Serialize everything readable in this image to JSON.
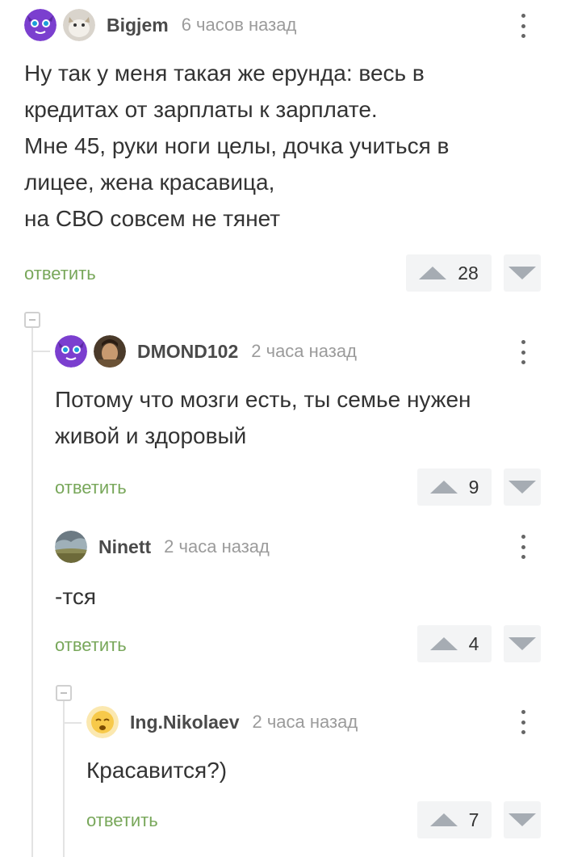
{
  "comments": [
    {
      "username": "Bigjem",
      "time": "6 часов назад",
      "text": "Ну так у меня такая же ерунда: весь в\nкредитах от зарплаты к зарплате.\nМне 45, руки ноги целы, дочка учиться в\nлицее, жена красавица,\nна СВО совсем не тянет",
      "reply_label": "ответить",
      "rating": "28"
    },
    {
      "username": "DMOND102",
      "time": "2 часа назад",
      "text": "Потому что мозги есть, ты семье нужен\nживой и здоровый",
      "reply_label": "ответить",
      "rating": "9"
    },
    {
      "username": "Ninett",
      "time": "2 часа назад",
      "text": "-тся",
      "reply_label": "ответить",
      "rating": "4"
    },
    {
      "username": "Ing.Nikolaev",
      "time": "2 часа назад",
      "text": "Красавится?)",
      "reply_label": "ответить",
      "rating": "7"
    }
  ],
  "colors": {
    "reply": "#78a75a",
    "vote_bg": "#f3f4f5",
    "vote_arrow": "#a6acb3",
    "avatar_purple": "#7b3fcf"
  }
}
